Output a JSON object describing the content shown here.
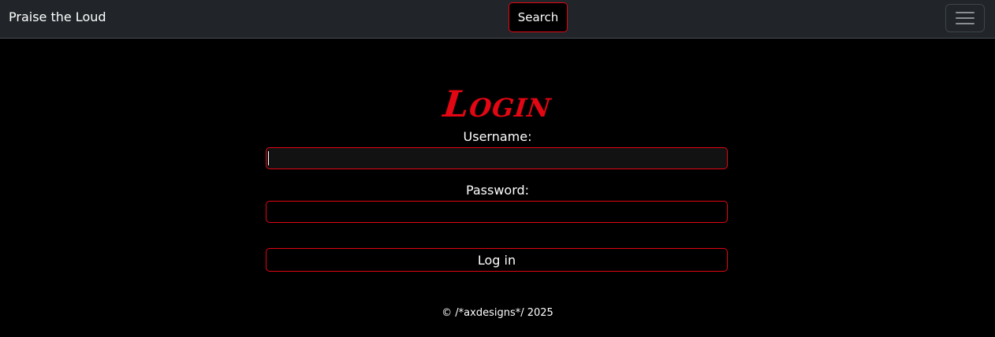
{
  "navbar": {
    "brand": "Praise the Loud",
    "search_label": "Search",
    "menu_icon": "hamburger-menu-icon"
  },
  "login": {
    "title": "Login",
    "username_label": "Username:",
    "username_value": "",
    "password_label": "Password:",
    "password_value": "",
    "submit_label": "Log in"
  },
  "footer": {
    "text": "© /*axdesigns*/ 2025"
  },
  "colors": {
    "accent": "#e30613",
    "navbar_bg": "#212529",
    "page_bg": "#000000"
  }
}
